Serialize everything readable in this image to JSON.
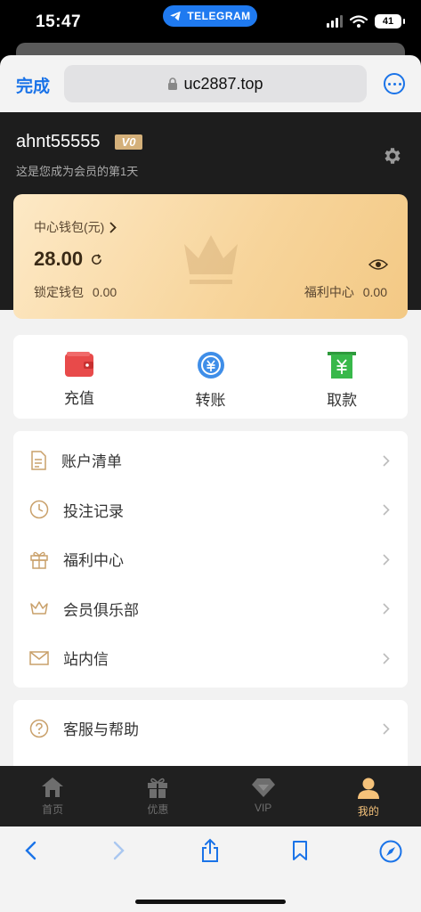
{
  "status_bar": {
    "time": "15:47",
    "pill_label": "TELEGRAM",
    "battery": "41"
  },
  "browser": {
    "done_label": "完成",
    "url": "uc2887.top"
  },
  "profile": {
    "username": "ahnt55555",
    "vip_badge": "V0",
    "member_days_text": "这是您成为会员的第1天"
  },
  "wallet": {
    "title": "中心钱包(元)",
    "amount": "28.00",
    "locked_label": "锁定钱包",
    "locked_value": "0.00",
    "welfare_label": "福利中心",
    "welfare_value": "0.00"
  },
  "actions": [
    {
      "label": "充值",
      "icon": "wallet-icon",
      "color": "#e84a4a"
    },
    {
      "label": "转账",
      "icon": "transfer-icon",
      "color": "#3f8ee8"
    },
    {
      "label": "取款",
      "icon": "withdraw-icon",
      "color": "#38b84a"
    }
  ],
  "menu": [
    {
      "label": "账户清单",
      "icon": "document-icon"
    },
    {
      "label": "投注记录",
      "icon": "clock-icon"
    },
    {
      "label": "福利中心",
      "icon": "gift-box-icon"
    },
    {
      "label": "会员俱乐部",
      "icon": "crown-icon"
    },
    {
      "label": "站内信",
      "icon": "envelope-icon"
    }
  ],
  "menu2": [
    {
      "label": "客服与帮助",
      "icon": "help-icon"
    }
  ],
  "tabs": [
    {
      "label": "首页",
      "icon": "home-icon",
      "active": false
    },
    {
      "label": "优惠",
      "icon": "gift-icon",
      "active": false
    },
    {
      "label": "VIP",
      "icon": "diamond-icon",
      "active": false
    },
    {
      "label": "我的",
      "icon": "user-icon",
      "active": true
    }
  ],
  "colors": {
    "accent_gold": "#f5c27a",
    "link_blue": "#1a73e8"
  }
}
